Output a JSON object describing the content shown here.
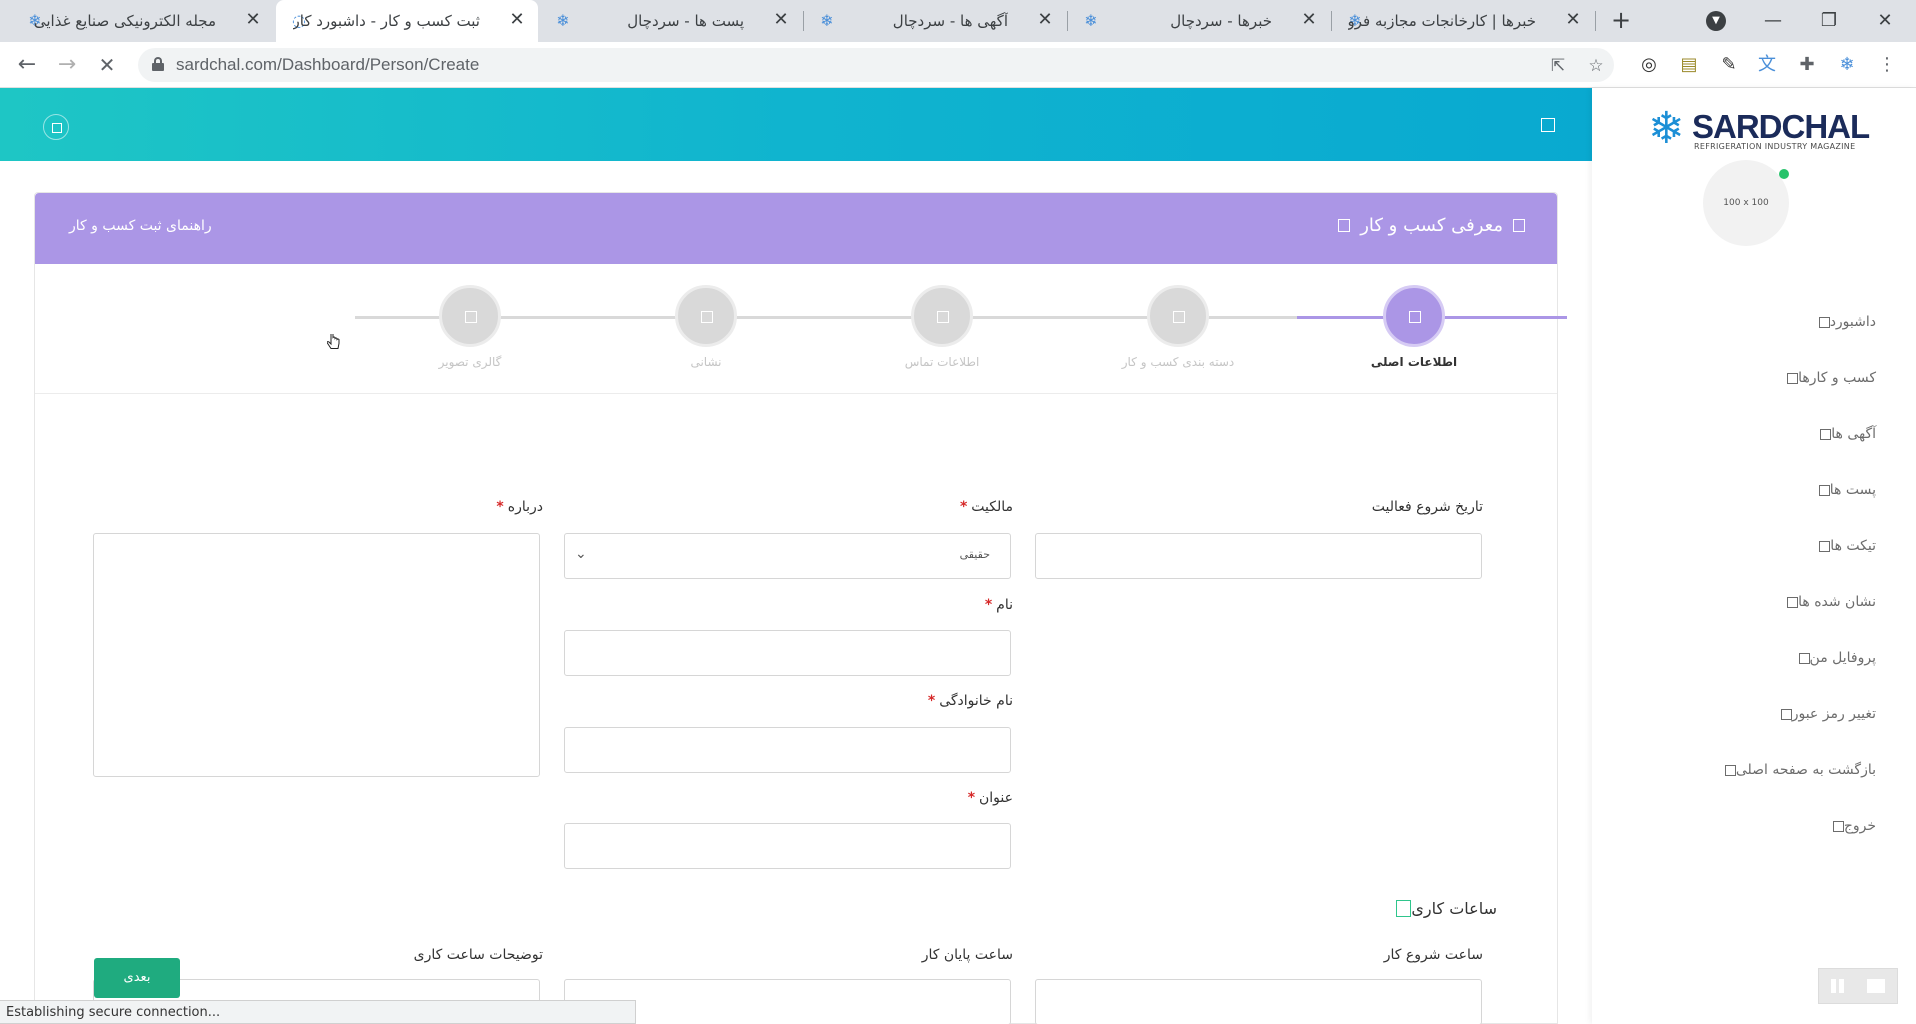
{
  "browser": {
    "tabs": [
      {
        "title": "مجله الکترونیکی صنایع غذایی",
        "active": false
      },
      {
        "title": "ثبت کسب و کار - داشبورد کار",
        "active": true
      },
      {
        "title": "پست ها - سردچال",
        "active": false
      },
      {
        "title": "آگهی ها - سردچال",
        "active": false
      },
      {
        "title": "خبرها - سردچال",
        "active": false
      },
      {
        "title": "خبرها | کارخانجات مجازبه فرو",
        "active": false
      }
    ],
    "url": "sardchal.com/Dashboard/Person/Create",
    "status_text": "Establishing secure connection..."
  },
  "sidebar": {
    "logo_text": "SARDCHAL",
    "logo_subtitle": "REFRIGERATION INDUSTRY MAGAZINE",
    "avatar_placeholder": "100 x 100",
    "menu": [
      {
        "label": "داشبورد",
        "icon": "square-icon"
      },
      {
        "label": "کسب و کارها",
        "icon": "square-icon"
      },
      {
        "label": "آگهی ها",
        "icon": "square-icon"
      },
      {
        "label": "پست ها",
        "icon": "square-icon"
      },
      {
        "label": "تیکت ها",
        "icon": "square-icon"
      },
      {
        "label": "نشان شده ها",
        "icon": "square-icon"
      },
      {
        "label": "پروفایل من",
        "icon": "square-icon"
      },
      {
        "label": "تغییر رمز عبور",
        "icon": "square-icon"
      },
      {
        "label": "بازگشت به صفحه اصلی",
        "icon": "square-icon"
      },
      {
        "label": "خروج",
        "icon": "square-icon"
      }
    ]
  },
  "card": {
    "title": "معرفی کسب و کار",
    "guide_link": "راهنمای ثبت کسب و کار"
  },
  "steps": [
    {
      "label": "اطلاعات اصلی",
      "active": true
    },
    {
      "label": "دسته بندی کسب و کار",
      "active": false
    },
    {
      "label": "اطلاعات تماس",
      "active": false
    },
    {
      "label": "نشانی",
      "active": false
    },
    {
      "label": "گالری تصویر",
      "active": false
    }
  ],
  "form": {
    "start_date_label": "تاریخ شروع فعالیت",
    "ownership_label": "مالکیت",
    "ownership_value": "حقیقی",
    "about_label": "درباره",
    "first_name_label": "نام",
    "last_name_label": "نام خانوادگی",
    "title_label": "عنوان",
    "required_mark": "*",
    "working_hours_label": "ساعات کاری",
    "work_start_label": "ساعت شروع کار",
    "work_end_label": "ساعت پایان کار",
    "work_desc_label": "توضیحات ساعت کاری",
    "next_button": "بعدی"
  },
  "colors": {
    "topbar": "#10b4cf",
    "card_header": "#ab96e6",
    "next_button": "#1fab7f",
    "required": "#d62828"
  }
}
